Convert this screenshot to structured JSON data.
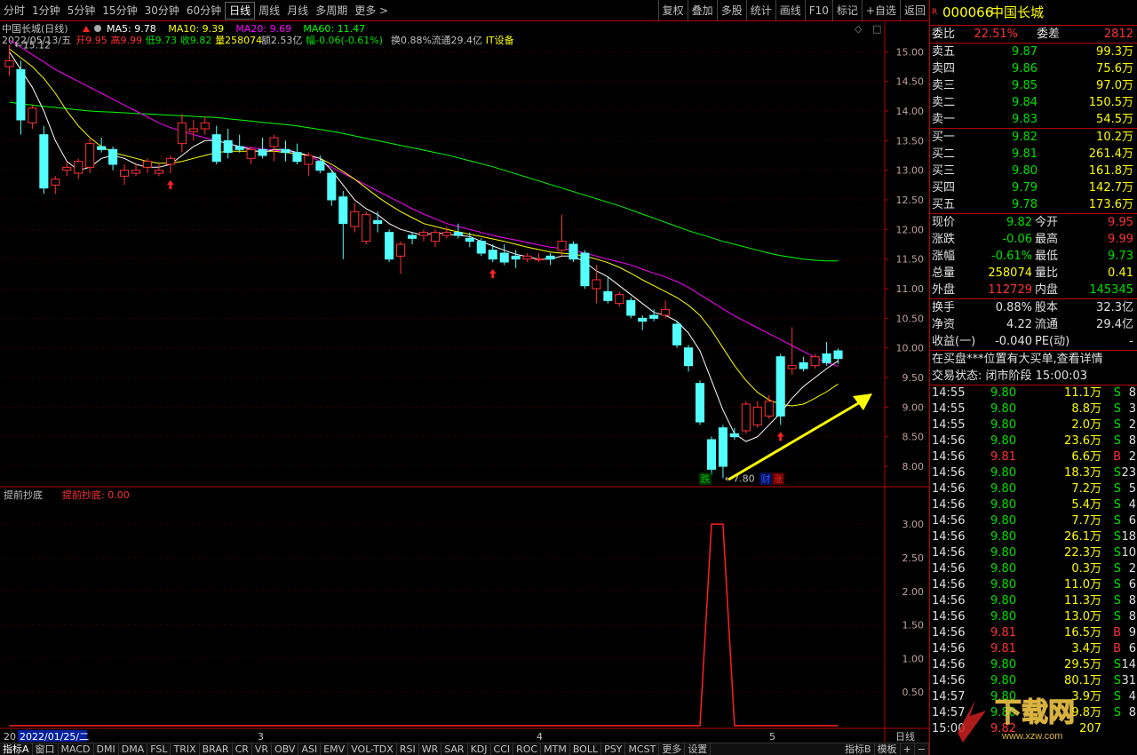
{
  "toolbar": {
    "periods": [
      "分时",
      "1分钟",
      "5分钟",
      "15分钟",
      "30分钟",
      "60分钟",
      "日线",
      "周线",
      "月线",
      "多周期",
      "更多 >"
    ],
    "active_index": 6,
    "actions": [
      "复权",
      "叠加",
      "多股",
      "统计",
      "画线",
      "F10",
      "标记",
      "+自选",
      "返回"
    ]
  },
  "chart": {
    "stock_title": "中国长城(日线)",
    "ma": [
      {
        "label": "MA5: 9.78",
        "color": "#ffffff"
      },
      {
        "label": "MA10: 9.39",
        "color": "#ffff00"
      },
      {
        "label": "MA20: 9.69",
        "color": "#ff00ff"
      },
      {
        "label": "MA60: 11.47",
        "color": "#00ff00"
      }
    ],
    "info_line": {
      "date": "2022/05/13/五",
      "open": "开9.95",
      "high": "高9.99",
      "low": "低9.73",
      "close": "收9.82",
      "volume": "量258074",
      "amount": "额2.53亿",
      "change": "幅-0.06(-0.61%)",
      "turnover": "换0.88%",
      "float": "流通29.4亿",
      "sector": "IT设备"
    },
    "high_label": "15.12",
    "low_label": "7.80",
    "markers": [
      "跌",
      "财",
      "涨"
    ],
    "indicator": {
      "name": "提前抄底",
      "value_label": "提前抄底: 0.00"
    },
    "month_labels": [
      "20",
      "3",
      "4",
      "5"
    ],
    "cursor_date": "2022/01/25/二",
    "period_btn": "日线"
  },
  "chart_data": {
    "type": "candlestick",
    "ylim": [
      7.7,
      15.2
    ],
    "y_ticks": [
      8.0,
      8.5,
      9.0,
      9.5,
      10.0,
      10.5,
      11.0,
      11.5,
      12.0,
      12.5,
      13.0,
      13.5,
      14.0,
      14.5,
      15.0
    ],
    "candles": [
      [
        14.75,
        15.12,
        14.6,
        14.85
      ],
      [
        14.7,
        14.85,
        13.6,
        13.85
      ],
      [
        13.8,
        14.1,
        13.7,
        14.05
      ],
      [
        13.6,
        13.75,
        12.6,
        12.7
      ],
      [
        12.75,
        12.9,
        12.6,
        12.85
      ],
      [
        13.0,
        13.15,
        12.9,
        13.05
      ],
      [
        12.95,
        13.2,
        12.85,
        13.15
      ],
      [
        13.05,
        13.55,
        12.95,
        13.45
      ],
      [
        13.4,
        13.55,
        13.3,
        13.35
      ],
      [
        13.35,
        13.4,
        13.0,
        13.1
      ],
      [
        12.9,
        13.1,
        12.75,
        13.0
      ],
      [
        12.95,
        13.1,
        12.9,
        13.0
      ],
      [
        13.05,
        13.2,
        12.95,
        13.15
      ],
      [
        12.95,
        13.1,
        12.9,
        13.0
      ],
      [
        13.1,
        13.25,
        12.95,
        13.2
      ],
      [
        13.45,
        13.95,
        13.3,
        13.8
      ],
      [
        13.65,
        13.85,
        13.5,
        13.7
      ],
      [
        13.7,
        13.9,
        13.6,
        13.8
      ],
      [
        13.6,
        13.75,
        13.1,
        13.15
      ],
      [
        13.5,
        13.7,
        13.2,
        13.3
      ],
      [
        13.4,
        13.6,
        13.3,
        13.35
      ],
      [
        13.2,
        13.4,
        13.1,
        13.35
      ],
      [
        13.35,
        13.55,
        13.2,
        13.25
      ],
      [
        13.4,
        13.6,
        13.15,
        13.55
      ],
      [
        13.35,
        13.5,
        13.15,
        13.3
      ],
      [
        13.3,
        13.45,
        13.1,
        13.15
      ],
      [
        13.1,
        13.3,
        12.9,
        13.25
      ],
      [
        13.15,
        13.25,
        12.95,
        13.0
      ],
      [
        12.95,
        13.0,
        12.4,
        12.5
      ],
      [
        12.55,
        12.65,
        11.5,
        12.1
      ],
      [
        12.05,
        12.45,
        11.95,
        12.3
      ],
      [
        11.8,
        12.3,
        11.75,
        12.25
      ],
      [
        12.15,
        12.3,
        11.95,
        12.1
      ],
      [
        11.95,
        12.0,
        11.45,
        11.5
      ],
      [
        11.55,
        11.8,
        11.25,
        11.75
      ],
      [
        11.9,
        11.95,
        11.75,
        11.85
      ],
      [
        11.9,
        12.0,
        11.8,
        11.95
      ],
      [
        11.8,
        12.0,
        11.7,
        11.95
      ],
      [
        11.9,
        12.05,
        11.85,
        11.95
      ],
      [
        11.95,
        12.1,
        11.85,
        11.9
      ],
      [
        11.85,
        11.95,
        11.7,
        11.8
      ],
      [
        11.8,
        11.85,
        11.55,
        11.6
      ],
      [
        11.65,
        11.75,
        11.45,
        11.5
      ],
      [
        11.6,
        11.75,
        11.4,
        11.45
      ],
      [
        11.55,
        11.65,
        11.35,
        11.5
      ],
      [
        11.5,
        11.6,
        11.45,
        11.55
      ],
      [
        11.5,
        11.6,
        11.45,
        11.5
      ],
      [
        11.55,
        11.6,
        11.4,
        11.5
      ],
      [
        11.65,
        12.25,
        11.55,
        11.8
      ],
      [
        11.75,
        11.8,
        11.45,
        11.5
      ],
      [
        11.6,
        11.65,
        11.0,
        11.05
      ],
      [
        11.0,
        11.4,
        10.75,
        11.15
      ],
      [
        10.95,
        11.2,
        10.75,
        10.8
      ],
      [
        10.75,
        10.95,
        10.7,
        10.9
      ],
      [
        10.8,
        10.85,
        10.5,
        10.55
      ],
      [
        10.5,
        10.55,
        10.3,
        10.45
      ],
      [
        10.55,
        10.65,
        10.45,
        10.5
      ],
      [
        10.55,
        10.8,
        10.5,
        10.65
      ],
      [
        10.4,
        10.45,
        10.0,
        10.05
      ],
      [
        10.0,
        10.05,
        9.6,
        9.7
      ],
      [
        9.4,
        9.45,
        8.7,
        8.75
      ],
      [
        8.45,
        8.5,
        7.85,
        7.95
      ],
      [
        8.65,
        8.7,
        7.8,
        8.0
      ],
      [
        8.55,
        8.65,
        8.45,
        8.5
      ],
      [
        8.6,
        9.1,
        8.55,
        9.05
      ],
      [
        8.7,
        9.1,
        8.65,
        9.0
      ],
      [
        8.85,
        9.2,
        8.8,
        9.1
      ],
      [
        9.85,
        9.9,
        8.7,
        8.85
      ],
      [
        9.65,
        10.35,
        9.55,
        9.7
      ],
      [
        9.75,
        9.85,
        9.6,
        9.65
      ],
      [
        9.7,
        9.9,
        9.65,
        9.85
      ],
      [
        9.9,
        10.1,
        9.7,
        9.75
      ],
      [
        9.95,
        9.99,
        9.73,
        9.82
      ]
    ],
    "ma5": [
      15.0,
      14.7,
      14.4,
      14.0,
      13.5,
      13.15,
      13.0,
      13.05,
      13.2,
      13.25,
      13.2,
      13.1,
      13.05,
      13.05,
      13.1,
      13.25,
      13.4,
      13.5,
      13.5,
      13.45,
      13.4,
      13.35,
      13.3,
      13.35,
      13.35,
      13.3,
      13.25,
      13.2,
      13.0,
      12.75,
      12.5,
      12.35,
      12.25,
      12.1,
      12.0,
      11.95,
      11.9,
      11.95,
      11.92,
      11.9,
      11.88,
      11.8,
      11.72,
      11.65,
      11.58,
      11.54,
      11.5,
      11.5,
      11.55,
      11.55,
      11.45,
      11.3,
      11.2,
      11.05,
      10.9,
      10.75,
      10.6,
      10.55,
      10.45,
      10.25,
      9.95,
      9.45,
      8.95,
      8.55,
      8.42,
      8.5,
      8.7,
      8.9,
      9.15,
      9.35,
      9.5,
      9.65,
      9.78
    ],
    "ma10": [
      15.05,
      14.9,
      14.75,
      14.55,
      14.3,
      14.0,
      13.75,
      13.55,
      13.4,
      13.3,
      13.25,
      13.2,
      13.15,
      13.12,
      13.12,
      13.15,
      13.2,
      13.25,
      13.3,
      13.32,
      13.32,
      13.32,
      13.32,
      13.32,
      13.3,
      13.28,
      13.25,
      13.2,
      13.1,
      12.98,
      12.85,
      12.7,
      12.55,
      12.42,
      12.3,
      12.2,
      12.1,
      12.05,
      12.0,
      11.96,
      11.92,
      11.88,
      11.84,
      11.8,
      11.75,
      11.7,
      11.66,
      11.62,
      11.6,
      11.58,
      11.55,
      11.5,
      11.44,
      11.36,
      11.26,
      11.15,
      11.05,
      10.95,
      10.85,
      10.72,
      10.55,
      10.3,
      10.0,
      9.7,
      9.45,
      9.25,
      9.12,
      9.05,
      9.02,
      9.05,
      9.15,
      9.26,
      9.39
    ],
    "ma20": [
      15.2,
      15.08,
      14.95,
      14.83,
      14.7,
      14.6,
      14.5,
      14.4,
      14.3,
      14.2,
      14.1,
      14.0,
      13.9,
      13.8,
      13.72,
      13.66,
      13.6,
      13.55,
      13.5,
      13.45,
      13.4,
      13.38,
      13.36,
      13.34,
      13.32,
      13.3,
      13.25,
      13.15,
      13.05,
      12.95,
      12.85,
      12.75,
      12.65,
      12.55,
      12.45,
      12.35,
      12.26,
      12.18,
      12.1,
      12.05,
      12.0,
      11.95,
      11.9,
      11.86,
      11.82,
      11.78,
      11.74,
      11.7,
      11.68,
      11.65,
      11.6,
      11.55,
      11.5,
      11.45,
      11.4,
      11.33,
      11.26,
      11.2,
      11.12,
      11.02,
      10.9,
      10.78,
      10.66,
      10.54,
      10.44,
      10.34,
      10.24,
      10.14,
      10.04,
      9.94,
      9.84,
      9.75,
      9.69
    ],
    "ma60": [
      14.15,
      14.12,
      14.1,
      14.08,
      14.06,
      14.04,
      14.02,
      14.0,
      13.99,
      13.98,
      13.97,
      13.96,
      13.95,
      13.94,
      13.93,
      13.92,
      13.91,
      13.9,
      13.89,
      13.87,
      13.85,
      13.83,
      13.81,
      13.79,
      13.77,
      13.75,
      13.72,
      13.69,
      13.66,
      13.62,
      13.58,
      13.54,
      13.5,
      13.46,
      13.42,
      13.38,
      13.34,
      13.3,
      13.26,
      13.21,
      13.16,
      13.11,
      13.06,
      13.0,
      12.94,
      12.88,
      12.82,
      12.76,
      12.7,
      12.64,
      12.58,
      12.52,
      12.46,
      12.4,
      12.33,
      12.26,
      12.19,
      12.12,
      12.05,
      11.98,
      11.92,
      11.86,
      11.8,
      11.75,
      11.7,
      11.65,
      11.6,
      11.56,
      11.53,
      11.5,
      11.48,
      11.47,
      11.47
    ],
    "indicator": {
      "ylim": [
        0,
        3.2
      ],
      "y_ticks": [
        0.5,
        1.0,
        1.5,
        2.0,
        2.5,
        3.0
      ],
      "values": [
        0,
        0,
        0,
        0,
        0,
        0,
        0,
        0,
        0,
        0,
        0,
        0,
        0,
        0,
        0,
        0,
        0,
        0,
        0,
        0,
        0,
        0,
        0,
        0,
        0,
        0,
        0,
        0,
        0,
        0,
        0,
        0,
        0,
        0,
        0,
        0,
        0,
        0,
        0,
        0,
        0,
        0,
        0,
        0,
        0,
        0,
        0,
        0,
        0,
        0,
        0,
        0,
        0,
        0,
        0,
        0,
        0,
        0,
        0,
        0,
        0,
        3,
        3,
        0,
        0,
        0,
        0,
        0,
        0,
        0,
        0,
        0,
        0
      ]
    }
  },
  "quote": {
    "code": "000066",
    "name": "中国长城",
    "weibi_label": "委比",
    "weibi": "22.51%",
    "weicha_label": "委差",
    "weicha": "2812",
    "asks": [
      {
        "label": "卖五",
        "price": "9.87",
        "vol": "99.3万"
      },
      {
        "label": "卖四",
        "price": "9.86",
        "vol": "75.6万"
      },
      {
        "label": "卖三",
        "price": "9.85",
        "vol": "97.0万"
      },
      {
        "label": "卖二",
        "price": "9.84",
        "vol": "150.5万"
      },
      {
        "label": "卖一",
        "price": "9.83",
        "vol": "54.5万"
      }
    ],
    "bids": [
      {
        "label": "买一",
        "price": "9.82",
        "vol": "10.2万"
      },
      {
        "label": "买二",
        "price": "9.81",
        "vol": "261.4万"
      },
      {
        "label": "买三",
        "price": "9.80",
        "vol": "161.8万"
      },
      {
        "label": "买四",
        "price": "9.79",
        "vol": "142.7万"
      },
      {
        "label": "买五",
        "price": "9.78",
        "vol": "173.6万"
      }
    ],
    "stats": [
      {
        "l1": "现价",
        "v1": "9.82",
        "c1": "g",
        "l2": "今开",
        "v2": "9.95",
        "c2": "r"
      },
      {
        "l1": "涨跌",
        "v1": "-0.06",
        "c1": "g",
        "l2": "最高",
        "v2": "9.99",
        "c2": "r"
      },
      {
        "l1": "涨幅",
        "v1": "-0.61%",
        "c1": "g",
        "l2": "最低",
        "v2": "9.73",
        "c2": "g"
      },
      {
        "l1": "总量",
        "v1": "258074",
        "c1": "y",
        "l2": "量比",
        "v2": "0.41",
        "c2": "y"
      },
      {
        "l1": "外盘",
        "v1": "112729",
        "c1": "r",
        "l2": "内盘",
        "v2": "145345",
        "c2": "g"
      }
    ],
    "stats2": [
      {
        "l1": "换手",
        "v1": "0.88%",
        "l2": "股本",
        "v2": "32.3亿"
      },
      {
        "l1": "净资",
        "v1": "4.22",
        "l2": "流通",
        "v2": "29.4亿"
      },
      {
        "l1": "收益(一)",
        "v1": "-0.040",
        "l2": "PE(动)",
        "v2": "-"
      }
    ],
    "notice": "在买盘***位置有大买单,查看详情",
    "status": "交易状态: 闭市阶段 15:00:03",
    "ticks": [
      [
        "14:55",
        "9.80",
        "11.1万",
        "S",
        "8"
      ],
      [
        "14:55",
        "9.80",
        "8.8万",
        "S",
        "3"
      ],
      [
        "14:55",
        "9.80",
        "2.0万",
        "S",
        "2"
      ],
      [
        "14:56",
        "9.80",
        "23.6万",
        "S",
        "8"
      ],
      [
        "14:56",
        "9.81",
        "6.6万",
        "B",
        "2"
      ],
      [
        "14:56",
        "9.80",
        "18.3万",
        "S",
        "23"
      ],
      [
        "14:56",
        "9.80",
        "7.2万",
        "S",
        "5"
      ],
      [
        "14:56",
        "9.80",
        "5.4万",
        "S",
        "4"
      ],
      [
        "14:56",
        "9.80",
        "7.7万",
        "S",
        "6"
      ],
      [
        "14:56",
        "9.80",
        "26.1万",
        "S",
        "18"
      ],
      [
        "14:56",
        "9.80",
        "22.3万",
        "S",
        "10"
      ],
      [
        "14:56",
        "9.80",
        "0.3万",
        "S",
        "2"
      ],
      [
        "14:56",
        "9.80",
        "11.0万",
        "S",
        "6"
      ],
      [
        "14:56",
        "9.80",
        "11.3万",
        "S",
        "8"
      ],
      [
        "14:56",
        "9.80",
        "13.0万",
        "S",
        "8"
      ],
      [
        "14:56",
        "9.81",
        "16.5万",
        "B",
        "9"
      ],
      [
        "14:56",
        "9.81",
        "3.4万",
        "B",
        "6"
      ],
      [
        "14:56",
        "9.80",
        "29.5万",
        "S",
        "14"
      ],
      [
        "14:56",
        "9.80",
        "80.1万",
        "S",
        "31"
      ],
      [
        "14:57",
        "9.80",
        "3.9万",
        "S",
        "4"
      ],
      [
        "14:57",
        "9.80",
        "9.8万",
        "S",
        "8"
      ],
      [
        "15:00",
        "9.82",
        "207",
        "",
        ""
      ]
    ]
  },
  "tabs": [
    "指标A",
    "窗口",
    "MACD",
    "DMI",
    "DMA",
    "FSL",
    "TRIX",
    "BRAR",
    "CR",
    "VR",
    "OBV",
    "ASI",
    "EMV",
    "VOL-TDX",
    "RSI",
    "WR",
    "SAR",
    "KDJ",
    "CCI",
    "ROC",
    "MTM",
    "BOLL",
    "PSY",
    "MCST",
    "更多",
    "设置"
  ],
  "tabs_right": [
    "指标B",
    "模板",
    "+",
    "−"
  ],
  "watermark": {
    "text": "下载网",
    "sub": "www.xzw.com"
  }
}
